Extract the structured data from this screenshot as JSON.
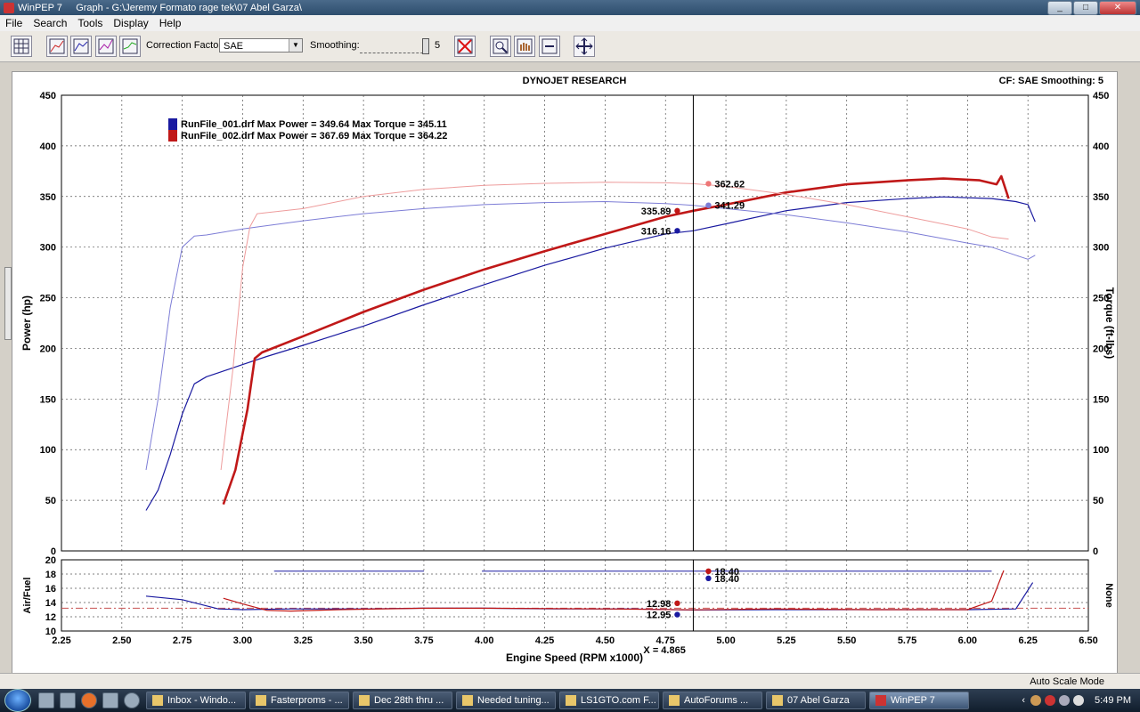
{
  "window": {
    "title": "WinPEP 7     Graph - G:\\Jeremy Formato rage tek\\07 Abel Garza\\",
    "min": "_",
    "max": "□",
    "close": "✕"
  },
  "menu": [
    "File",
    "Search",
    "Tools",
    "Display",
    "Help"
  ],
  "toolbar": {
    "cf_label": "Correction Factor:",
    "cf_value": "SAE",
    "smoothing_label": "Smoothing:",
    "smoothing_value": "5"
  },
  "graph": {
    "header_center": "DYNOJET RESEARCH",
    "header_right": "CF: SAE  Smoothing: 5",
    "legend": [
      {
        "text": "RunFile_001.drf Max Power = 349.64 Max Torque = 345.11",
        "color": "#1a1aa0"
      },
      {
        "text": "RunFile_002.drf Max Power = 367.69 Max Torque = 364.22",
        "color": "#c01818"
      }
    ],
    "cursor_label": "X = 4.865"
  },
  "status": {
    "mode": "Auto Scale Mode"
  },
  "taskbar": {
    "tasks": [
      "Inbox - Windo...",
      "Fasterproms - ...",
      "Dec 28th thru ...",
      "Needed tuning...",
      "LS1GTO.com F...",
      "AutoForums ...",
      "07 Abel Garza",
      "WinPEP 7"
    ],
    "clock": "5:49 PM"
  },
  "chart_data": [
    {
      "type": "line",
      "xlabel": "Engine Speed (RPM x1000)",
      "ylabel": "Power (hp)",
      "y2label": "Torque (ft-lbs)",
      "xlim": [
        2.25,
        6.5
      ],
      "ylim": [
        0,
        450
      ],
      "y2lim": [
        0,
        450
      ],
      "xticks": [
        "2.25",
        "2.50",
        "2.75",
        "3.00",
        "3.25",
        "3.50",
        "3.75",
        "4.00",
        "4.25",
        "4.50",
        "4.75",
        "5.00",
        "5.25",
        "5.50",
        "5.75",
        "6.00",
        "6.25",
        "6.50"
      ],
      "yticks": [
        "0",
        "50",
        "100",
        "150",
        "200",
        "250",
        "300",
        "350",
        "400",
        "450"
      ],
      "grid": true,
      "series": [
        {
          "name": "RunFile_001.drf",
          "kind": "power",
          "color": "#1a1aa0",
          "width": 1.2,
          "x": [
            2.6,
            2.65,
            2.7,
            2.75,
            2.8,
            2.85,
            2.9,
            3.0,
            3.1,
            3.25,
            3.5,
            3.75,
            4.0,
            4.25,
            4.5,
            4.75,
            4.865,
            5.0,
            5.25,
            5.5,
            5.75,
            5.9,
            6.1,
            6.2,
            6.25,
            6.28
          ],
          "y": [
            40,
            60,
            95,
            135,
            165,
            172,
            176,
            184,
            192,
            203,
            222,
            243,
            263,
            282,
            299,
            313,
            316.16,
            323,
            336,
            344,
            348,
            349.6,
            348,
            345,
            342,
            325
          ]
        },
        {
          "name": "RunFile_001.drf",
          "kind": "torque",
          "color": "#7d7dd6",
          "width": 1,
          "x": [
            2.6,
            2.65,
            2.7,
            2.75,
            2.8,
            2.85,
            2.9,
            3.0,
            3.25,
            3.5,
            3.75,
            4.0,
            4.25,
            4.5,
            4.75,
            4.865,
            5.0,
            5.25,
            5.5,
            5.75,
            6.0,
            6.1,
            6.2,
            6.25,
            6.28
          ],
          "y": [
            80,
            150,
            240,
            300,
            311,
            312,
            314,
            318,
            326,
            333,
            338,
            342,
            344,
            345,
            343,
            341.29,
            338,
            332,
            324,
            315,
            304,
            300,
            292,
            288,
            292
          ]
        },
        {
          "name": "RunFile_002.drf",
          "kind": "power",
          "color": "#c01818",
          "width": 2.6,
          "x": [
            2.92,
            2.97,
            3.02,
            3.05,
            3.08,
            3.25,
            3.5,
            3.75,
            4.0,
            4.25,
            4.5,
            4.75,
            4.865,
            5.0,
            5.25,
            5.5,
            5.75,
            5.9,
            6.05,
            6.12,
            6.14,
            6.17
          ],
          "y": [
            46,
            80,
            140,
            190,
            196,
            212,
            236,
            258,
            278,
            296,
            313,
            330,
            335.89,
            342,
            354,
            362,
            366,
            367.7,
            366,
            362,
            370,
            348
          ]
        },
        {
          "name": "RunFile_002.drf",
          "kind": "torque",
          "color": "#ee9c9c",
          "width": 1,
          "x": [
            2.91,
            2.96,
            3.0,
            3.03,
            3.06,
            3.25,
            3.5,
            3.75,
            4.0,
            4.25,
            4.5,
            4.75,
            4.865,
            5.0,
            5.25,
            5.5,
            5.75,
            6.0,
            6.1,
            6.17
          ],
          "y": [
            80,
            180,
            280,
            320,
            333,
            338,
            350,
            357,
            361,
            363,
            364,
            363.5,
            362.62,
            360,
            352,
            342,
            330,
            318,
            310,
            308
          ]
        }
      ],
      "cursor": {
        "x": 4.865,
        "labels": [
          {
            "value": "362.62",
            "y": 362.62,
            "color": "#ee7777",
            "side": "right"
          },
          {
            "value": "341.29",
            "y": 341.29,
            "color": "#7d7dd6",
            "side": "right"
          },
          {
            "value": "335.89",
            "y": 335.89,
            "color": "#c01818",
            "side": "left"
          },
          {
            "value": "316.16",
            "y": 316.16,
            "color": "#1a1aa0",
            "side": "left"
          }
        ]
      }
    },
    {
      "type": "line",
      "xlabel": "Engine Speed (RPM x1000)",
      "ylabel": "Air/Fuel",
      "y2label": "None",
      "xlim": [
        2.25,
        6.5
      ],
      "ylim": [
        10,
        20
      ],
      "yticks": [
        "10",
        "12",
        "14",
        "16",
        "18",
        "20"
      ],
      "reference_line": 13.2,
      "series": [
        {
          "name": "RunFile_001.drf",
          "color": "#1a1aa0",
          "x": [
            2.6,
            2.75,
            2.9,
            3.0,
            3.2,
            3.5,
            3.75,
            4.0,
            4.3,
            4.6,
            4.865,
            5.2,
            5.6,
            6.0,
            6.2,
            6.27
          ],
          "y": [
            14.9,
            14.4,
            13.1,
            13.0,
            13.1,
            13.1,
            13.2,
            13.2,
            13.1,
            13.1,
            12.95,
            13.0,
            13.0,
            13.0,
            13.1,
            16.8
          ]
        },
        {
          "name": "RunFile_002.drf",
          "color": "#c01818",
          "x": [
            2.92,
            3.0,
            3.1,
            3.2,
            3.4,
            3.75,
            4.0,
            4.5,
            4.865,
            5.2,
            5.6,
            6.0,
            6.1,
            6.15
          ],
          "y": [
            14.6,
            13.8,
            12.9,
            12.8,
            13.0,
            13.2,
            13.2,
            13.1,
            12.98,
            13.1,
            13.0,
            13.0,
            14.2,
            18.5
          ]
        },
        {
          "name": "RunFile_001.drf",
          "kind": "lean-cut",
          "color": "#1a1aa0",
          "x": [
            3.13,
            3.75,
            3.99,
            6.1
          ],
          "y": [
            18.4,
            18.4,
            18.4,
            18.4
          ],
          "segments": [
            [
              3.13,
              3.75
            ],
            [
              3.99,
              6.1
            ]
          ]
        }
      ],
      "cursor": {
        "x": 4.865,
        "labels": [
          {
            "value": "18.40",
            "y": 18.4,
            "color": "#c01818",
            "side": "right",
            "dy": 0
          },
          {
            "value": "18.40",
            "y": 17.4,
            "color": "#1a1aa0",
            "side": "right",
            "dy": 0
          },
          {
            "value": "12.98",
            "y": 13.9,
            "color": "#c01818",
            "side": "left",
            "dy": 0
          },
          {
            "value": "12.95",
            "y": 12.3,
            "color": "#1a1aa0",
            "side": "left",
            "dy": 0
          }
        ]
      }
    }
  ]
}
